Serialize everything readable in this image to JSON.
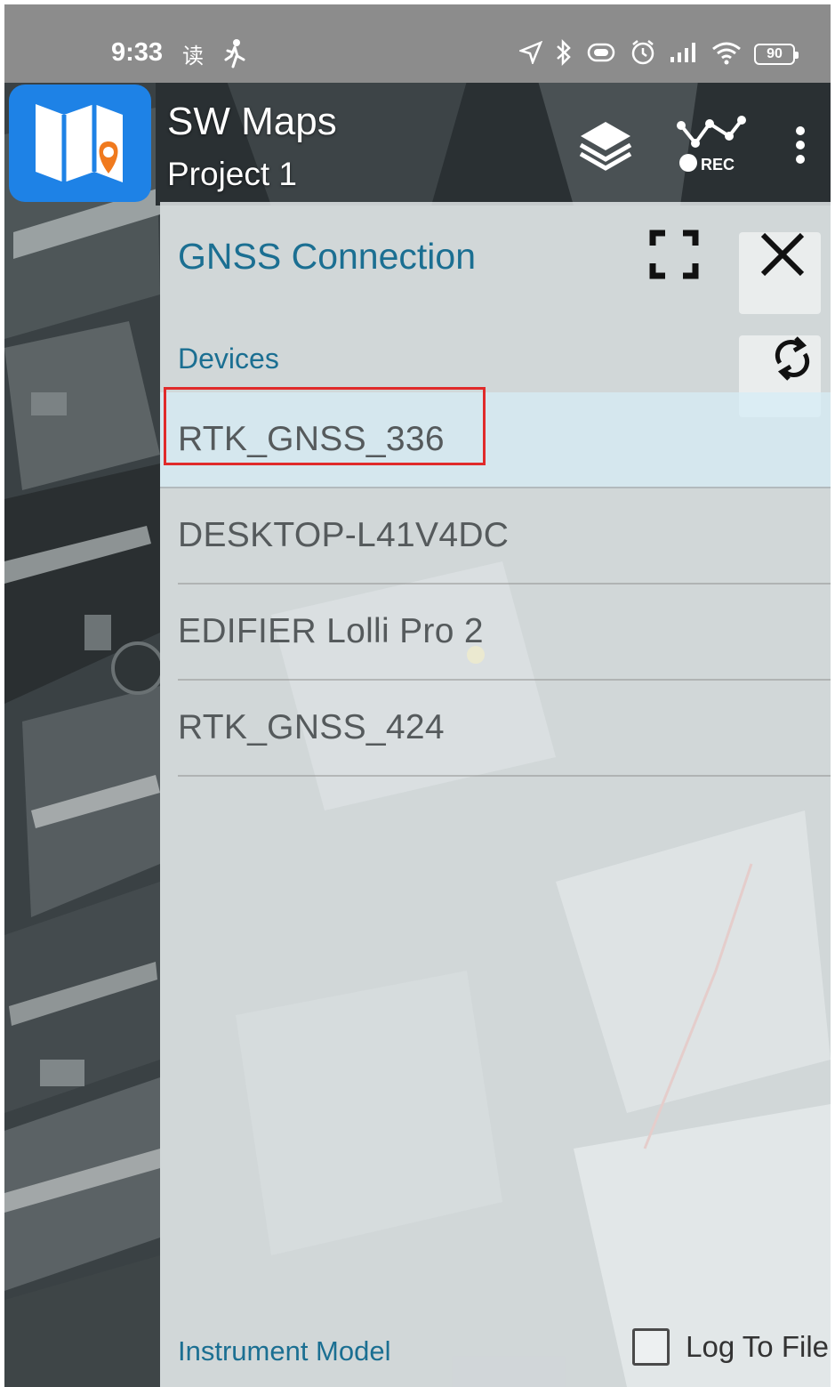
{
  "status_bar": {
    "time": "9:33",
    "glyph_read": "读",
    "glyph_walk": "🚶",
    "battery": "90"
  },
  "app": {
    "title": "SW Maps",
    "subtitle": "Project 1",
    "icon": "folded-map-pin-icon"
  },
  "panel": {
    "title": "GNSS Connection",
    "section_label": "Devices",
    "devices": [
      "RTK_GNSS_336",
      "DESKTOP-L41V4DC",
      "EDIFIER Lolli Pro 2",
      "RTK_GNSS_424"
    ],
    "footer": {
      "instrument_model_label": "Instrument Model",
      "log_to_file_label": "Log To File",
      "log_to_file_checked": false
    }
  },
  "colors": {
    "accent": "#1b6f92",
    "app_icon_bg": "#1e82e6",
    "pin": "#f07a1e",
    "highlight": "#e02a2a"
  }
}
